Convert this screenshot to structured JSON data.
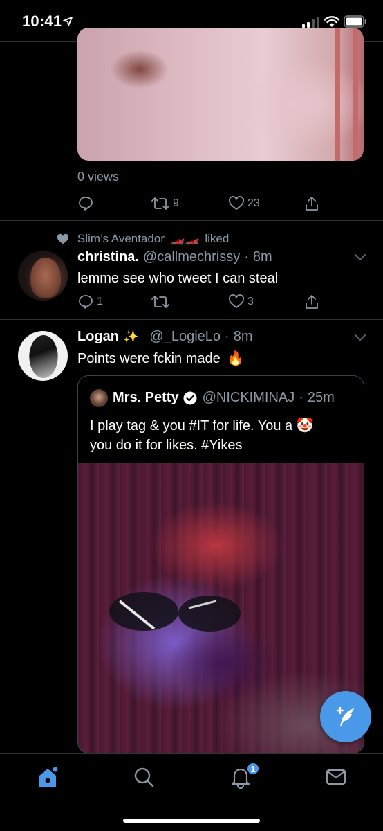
{
  "status_bar": {
    "time": "10:41"
  },
  "tweet1": {
    "views": "0 views",
    "actions": {
      "reply": "",
      "retweet": "9",
      "like": "23"
    }
  },
  "tweet2": {
    "social_context": {
      "name": "Slim’s Aventador",
      "emoji": "🏎️🏎️",
      "action": "liked"
    },
    "name": "christina.",
    "handle": "@callmechrissy",
    "time": "8m",
    "text": "lemme see who tweet I can steal",
    "actions": {
      "reply": "1",
      "retweet": "",
      "like": "3"
    }
  },
  "tweet3": {
    "name": "Logan",
    "name_emoji": "✨",
    "handle": "@_LogieLo",
    "time": "8m",
    "text": "Points were fckin made",
    "text_emoji": "🔥",
    "quote": {
      "name": "Mrs. Petty",
      "verified": true,
      "handle": "@NICKIMINAJ",
      "time": "25m",
      "text_line1": "I play tag & you #IT for life. You a",
      "text_emoji": "🤡",
      "text_line2": "you do it for likes. #Yikes"
    }
  },
  "tab_bar": {
    "notifications_badge": "1"
  },
  "colors": {
    "accent": "#4a99e9",
    "background": "#000000",
    "muted": "#8b98a5",
    "divider": "#2f3336"
  }
}
